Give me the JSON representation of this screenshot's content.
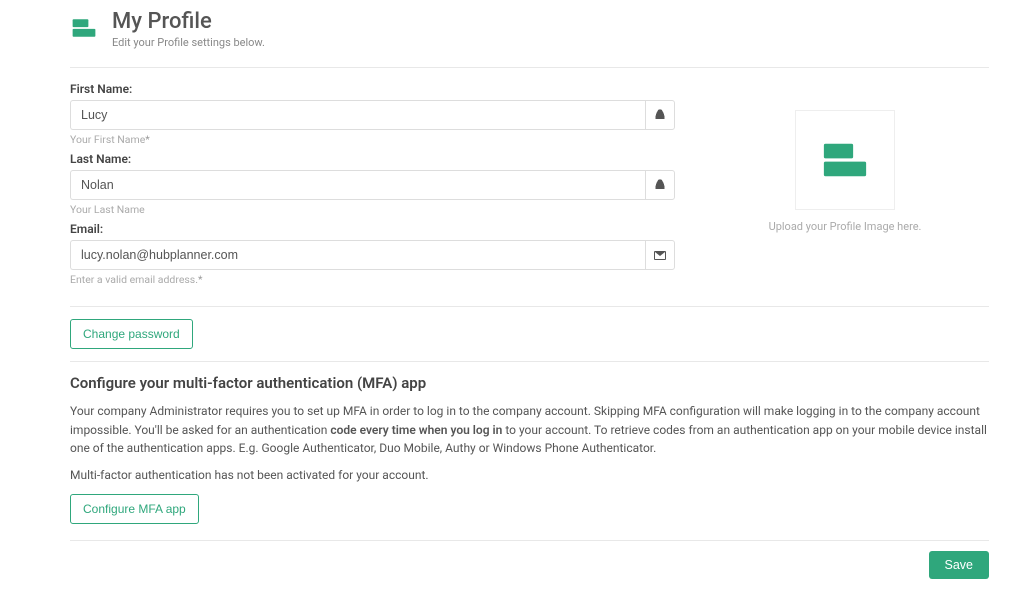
{
  "header": {
    "title": "My Profile",
    "subtitle": "Edit your Profile settings below."
  },
  "fields": {
    "first_name": {
      "label": "First Name:",
      "value": "Lucy",
      "help": "Your First Name",
      "required_mark": "*"
    },
    "last_name": {
      "label": "Last Name:",
      "value": "Nolan",
      "help": "Your Last Name"
    },
    "email": {
      "label": "Email:",
      "value": "lucy.nolan@hubplanner.com",
      "help": "Enter a valid email address.",
      "required_mark": "*"
    }
  },
  "avatar": {
    "caption": "Upload your Profile Image here."
  },
  "buttons": {
    "change_password": "Change password",
    "configure_mfa": "Configure MFA app",
    "save": "Save"
  },
  "mfa": {
    "title": "Configure your multi-factor authentication (MFA) app",
    "body_pre": "Your company Administrator requires you to set up MFA in order to log in to the company account. Skipping MFA configuration will make logging in to the company account impossible. You'll be asked for an authentication ",
    "body_bold": "code every time when you log in",
    "body_post": " to your account. To retrieve codes from an authentication app on your mobile device install one of the authentication apps. E.g. Google Authenticator, Duo Mobile, Authy or Windows Phone Authenticator.",
    "status": "Multi-factor authentication has not been activated for your account."
  },
  "colors": {
    "accent": "#2fa77c"
  }
}
